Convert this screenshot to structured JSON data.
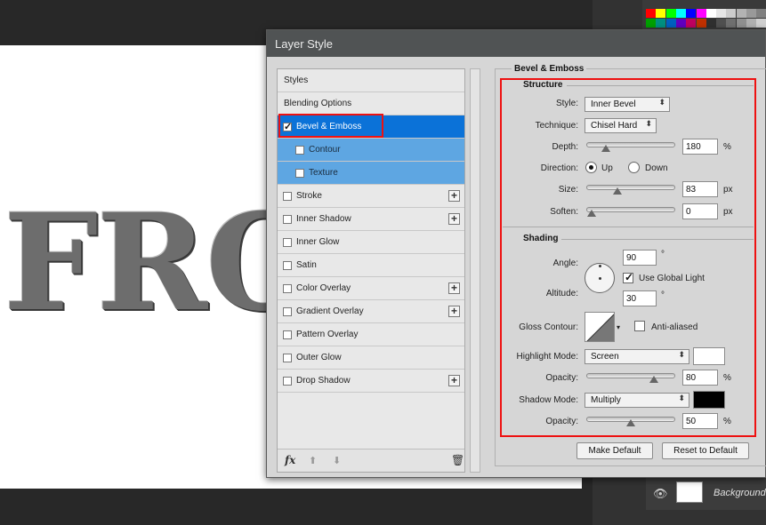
{
  "canvas": {
    "text": "FRO"
  },
  "layers": {
    "background_label": "Background"
  },
  "dialog": {
    "title": "Layer Style"
  },
  "style_list": {
    "items": [
      {
        "label": "Styles",
        "checkbox": false,
        "checked": false,
        "plus": false,
        "state": "normal"
      },
      {
        "label": "Blending Options",
        "checkbox": false,
        "checked": false,
        "plus": false,
        "state": "normal"
      },
      {
        "label": "Bevel & Emboss",
        "checkbox": true,
        "checked": true,
        "plus": false,
        "state": "selected"
      },
      {
        "label": "Contour",
        "checkbox": true,
        "checked": false,
        "plus": false,
        "state": "sub"
      },
      {
        "label": "Texture",
        "checkbox": true,
        "checked": false,
        "plus": false,
        "state": "sub"
      },
      {
        "label": "Stroke",
        "checkbox": true,
        "checked": false,
        "plus": true,
        "state": "normal"
      },
      {
        "label": "Inner Shadow",
        "checkbox": true,
        "checked": false,
        "plus": true,
        "state": "normal"
      },
      {
        "label": "Inner Glow",
        "checkbox": true,
        "checked": false,
        "plus": false,
        "state": "normal"
      },
      {
        "label": "Satin",
        "checkbox": true,
        "checked": false,
        "plus": false,
        "state": "normal"
      },
      {
        "label": "Color Overlay",
        "checkbox": true,
        "checked": false,
        "plus": true,
        "state": "normal"
      },
      {
        "label": "Gradient Overlay",
        "checkbox": true,
        "checked": false,
        "plus": true,
        "state": "normal"
      },
      {
        "label": "Pattern Overlay",
        "checkbox": true,
        "checked": false,
        "plus": false,
        "state": "normal"
      },
      {
        "label": "Outer Glow",
        "checkbox": true,
        "checked": false,
        "plus": false,
        "state": "normal"
      },
      {
        "label": "Drop Shadow",
        "checkbox": true,
        "checked": false,
        "plus": true,
        "state": "normal"
      }
    ],
    "footer": {
      "fx_label": "fx"
    }
  },
  "bevel": {
    "section_title": "Bevel & Emboss",
    "structure_title": "Structure",
    "style_label": "Style:",
    "style_value": "Inner Bevel",
    "technique_label": "Technique:",
    "technique_value": "Chisel Hard",
    "depth_label": "Depth:",
    "depth_value": "180",
    "depth_unit": "%",
    "depth_level": 0.18,
    "direction_label": "Direction:",
    "direction_up": "Up",
    "direction_down": "Down",
    "direction_selected": "Up",
    "size_label": "Size:",
    "size_value": "83",
    "size_unit": "px",
    "size_level": 0.33,
    "soften_label": "Soften:",
    "soften_value": "0",
    "soften_unit": "px",
    "soften_level": 0.0
  },
  "shading": {
    "title": "Shading",
    "angle_label": "Angle:",
    "angle_value": "90",
    "angle_unit": "°",
    "global_light_label": "Use Global Light",
    "global_light_checked": true,
    "altitude_label": "Altitude:",
    "altitude_value": "30",
    "altitude_unit": "°",
    "gloss_label": "Gloss Contour:",
    "anti_aliased_label": "Anti-aliased",
    "anti_aliased_checked": false,
    "highlight_mode_label": "Highlight Mode:",
    "highlight_mode_value": "Screen",
    "highlight_color": "#ffffff",
    "highlight_opacity_label": "Opacity:",
    "highlight_opacity_value": "80",
    "highlight_opacity_unit": "%",
    "highlight_opacity_level": 0.8,
    "shadow_mode_label": "Shadow Mode:",
    "shadow_mode_value": "Multiply",
    "shadow_color": "#000000",
    "shadow_opacity_label": "Opacity:",
    "shadow_opacity_value": "50",
    "shadow_opacity_unit": "%",
    "shadow_opacity_level": 0.5
  },
  "buttons": {
    "make_default": "Make Default",
    "reset_default": "Reset to Default"
  },
  "colors": {
    "selection": "#0b72d8",
    "sub_selection": "#5ea6e2",
    "annotation_red": "#ee1111"
  }
}
